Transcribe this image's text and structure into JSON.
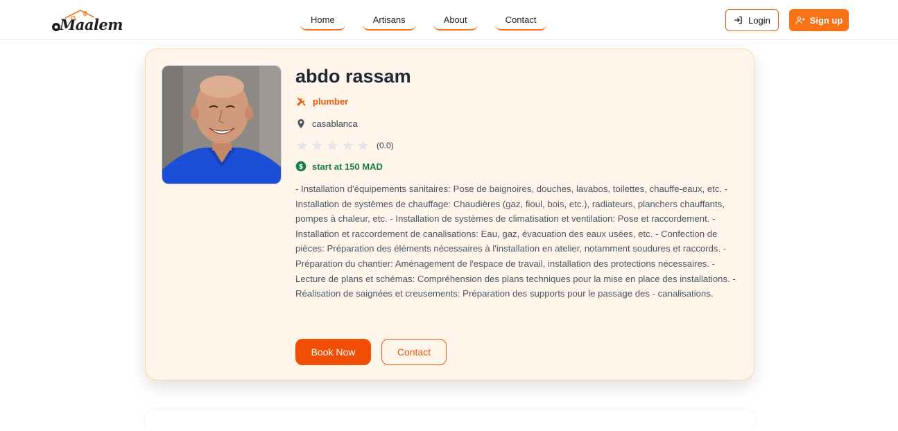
{
  "brand": {
    "name": "Maalem",
    "accent": "#f97316"
  },
  "nav": {
    "links": [
      "Home",
      "Artisans",
      "About",
      "Contact"
    ]
  },
  "auth": {
    "login_label": "Login",
    "signup_label": "Sign up"
  },
  "artisan": {
    "name": "abdo rassam",
    "profession": "plumber",
    "city": "casablanca",
    "rating": {
      "stars_filled": 0,
      "stars_total": 5,
      "label": "(0.0)"
    },
    "price": "start at 150 MAD",
    "description": "- Installation d'équipements sanitaires: Pose de baignoires, douches, lavabos, toilettes, chauffe-eaux, etc. - Installation de systèmes de chauffage: Chaudières (gaz, fioul, bois, etc.), radiateurs, planchers chauffants, pompes à chaleur, etc. - Installation de systèmes de climatisation et ventilation: Pose et raccordement. - Installation et raccordement de canalisations: Eau, gaz, évacuation des eaux usées, etc. - Confection de pièces: Préparation des éléments nécessaires à l'installation en atelier, notamment soudures et raccords. - Préparation du chantier: Aménagement de l'espace de travail, installation des protections nécessaires. - Lecture de plans et schémas: Compréhension des plans techniques pour la mise en place des installations. - Réalisation de saignées et creusements: Préparation des supports pour le passage des - canalisations."
  },
  "actions": {
    "book_label": "Book Now",
    "contact_label": "Contact"
  }
}
